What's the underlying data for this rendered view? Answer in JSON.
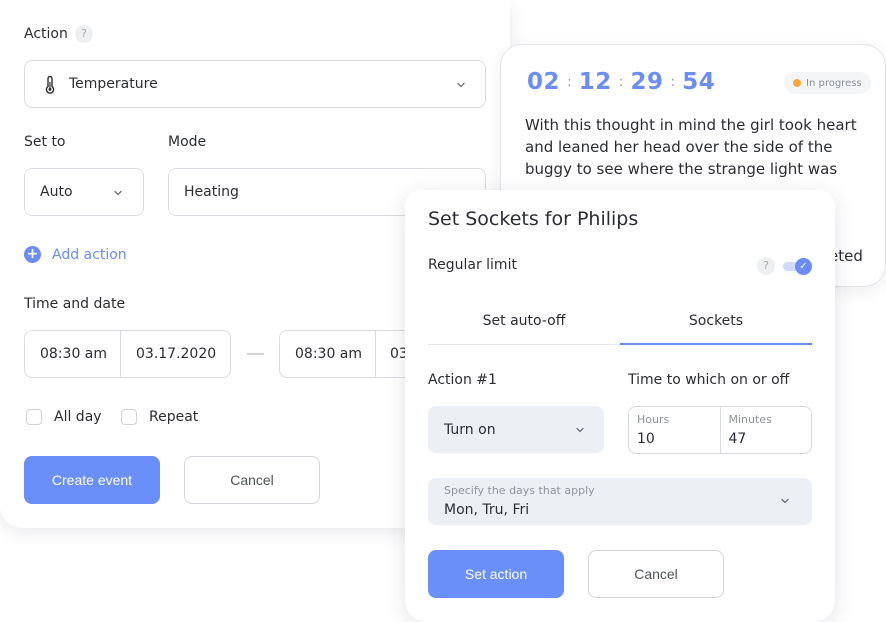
{
  "event_form": {
    "action_label": "Action",
    "help_glyph": "?",
    "action_select": {
      "icon": "thermometer-icon",
      "value": "Temperature"
    },
    "set_to_label": "Set to",
    "set_to_value": "Auto",
    "mode_label": "Mode",
    "mode_value": "Heating",
    "add_action_label": "Add action",
    "add_action_glyph": "+",
    "time_date_label": "Time and date",
    "start": {
      "time": "08:30 am",
      "date": "03.17.2020"
    },
    "end": {
      "time": "08:30 am",
      "date": "03"
    },
    "checkboxes": [
      {
        "label": "All day",
        "checked": false
      },
      {
        "label": "Repeat",
        "checked": false
      }
    ],
    "create_label": "Create event",
    "cancel_label": "Cancel"
  },
  "timer_card": {
    "hours": "02",
    "minutes": "12",
    "seconds": "29",
    "frames": "54",
    "separator": ":",
    "status": {
      "label": "In progress",
      "color": "#f6a93b"
    },
    "text": "With this thought in mind the girl took heart and leaned her head over the side of the buggy to see where the strange light was",
    "footer_fragment": "eted"
  },
  "sockets_card": {
    "title": "Set Sockets for Philips",
    "regular_limit_label": "Regular limit",
    "help_glyph": "?",
    "regular_limit_enabled": true,
    "toggle_glyph": "✓",
    "tabs": [
      {
        "label": "Set auto-off",
        "active": false
      },
      {
        "label": "Sockets",
        "active": true
      }
    ],
    "action_label": "Action #1",
    "action_value": "Turn on",
    "time_label": "Time to which on or off",
    "hours_label": "Hours",
    "hours_value": "10",
    "minutes_label": "Minutes",
    "minutes_value": "47",
    "days_label": "Specify the days that apply",
    "days_value": "Mon, Tru, Fri",
    "set_label": "Set action",
    "cancel_label": "Cancel"
  },
  "colors": {
    "accent": "#6b8df5",
    "primary_button": "#6b8ff9",
    "in_progress": "#f6a93b",
    "select_bg": "#ecf0f4"
  }
}
